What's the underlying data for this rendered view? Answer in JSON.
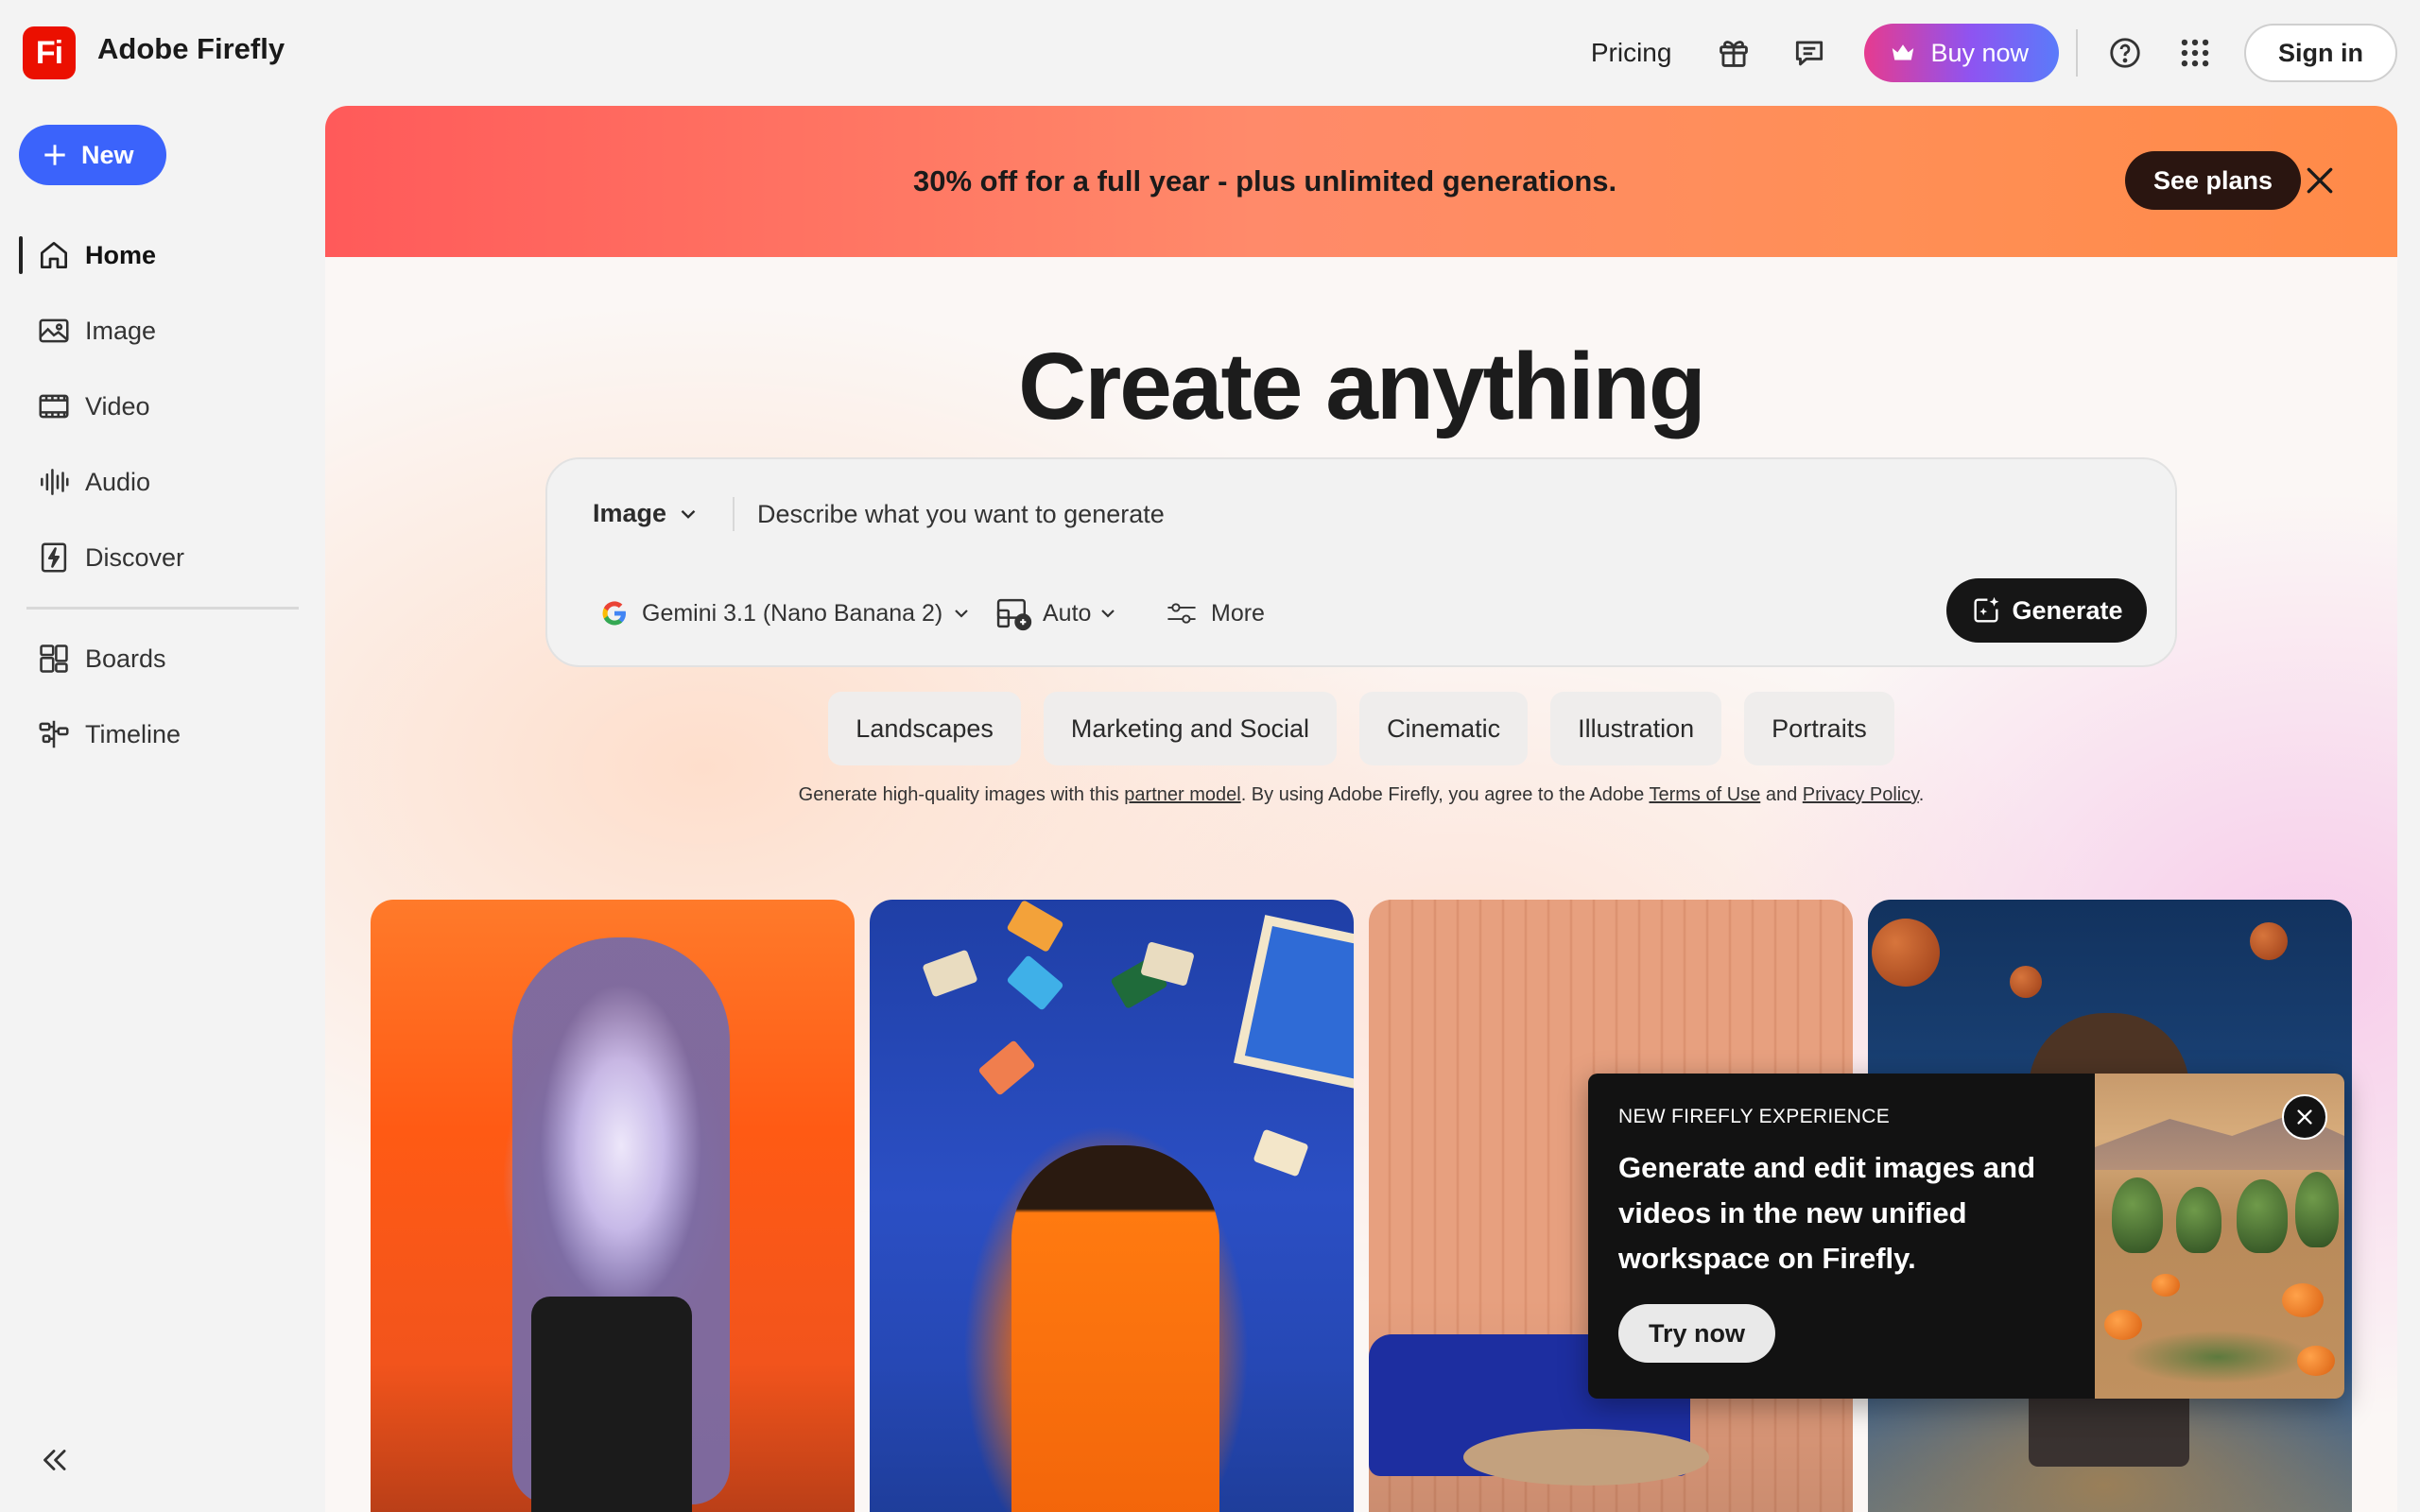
{
  "app": {
    "logo_text": "Fi",
    "title": "Adobe Firefly"
  },
  "topbar": {
    "pricing_label": "Pricing",
    "buy_label": "Buy now",
    "signin_label": "Sign in"
  },
  "sidebar": {
    "new_label": "New",
    "items": [
      {
        "label": "Home",
        "icon": "home-icon",
        "active": true
      },
      {
        "label": "Image",
        "icon": "image-icon"
      },
      {
        "label": "Video",
        "icon": "video-icon"
      },
      {
        "label": "Audio",
        "icon": "audio-icon"
      },
      {
        "label": "Discover",
        "icon": "discover-icon"
      },
      {
        "label": "Boards",
        "icon": "boards-icon"
      },
      {
        "label": "Timeline",
        "icon": "timeline-icon"
      }
    ]
  },
  "banner": {
    "text": "30% off for a full year  - plus unlimited generations.",
    "cta_label": "See plans"
  },
  "hero": {
    "headline": "Create anything"
  },
  "prompt": {
    "type_label": "Image",
    "placeholder": "Describe what you want to generate",
    "model_label": "Gemini 3.1 (Nano Banana 2)",
    "aspect_label": "Auto",
    "more_label": "More",
    "generate_label": "Generate"
  },
  "chips": [
    "Landscapes",
    "Marketing and Social",
    "Cinematic",
    "Illustration",
    "Portraits"
  ],
  "legal": {
    "prefix": "Generate high-quality images with this ",
    "partner_link": "partner model",
    "middle": ".  By using Adobe Firefly, you agree to the Adobe ",
    "terms_link": "Terms of Use",
    "and": " and ",
    "privacy_link": "Privacy Policy",
    "suffix": "."
  },
  "popup": {
    "kicker": "NEW FIREFLY EXPERIENCE",
    "body": "Generate and edit images and videos in the new unified workspace on Firefly.",
    "cta_label": "Try now"
  },
  "colors": {
    "accent_blue": "#3b63fb",
    "brand_red": "#eb1000",
    "banner_start": "#ff5a5a",
    "banner_end": "#ff8a48",
    "dark_button": "#161616"
  }
}
